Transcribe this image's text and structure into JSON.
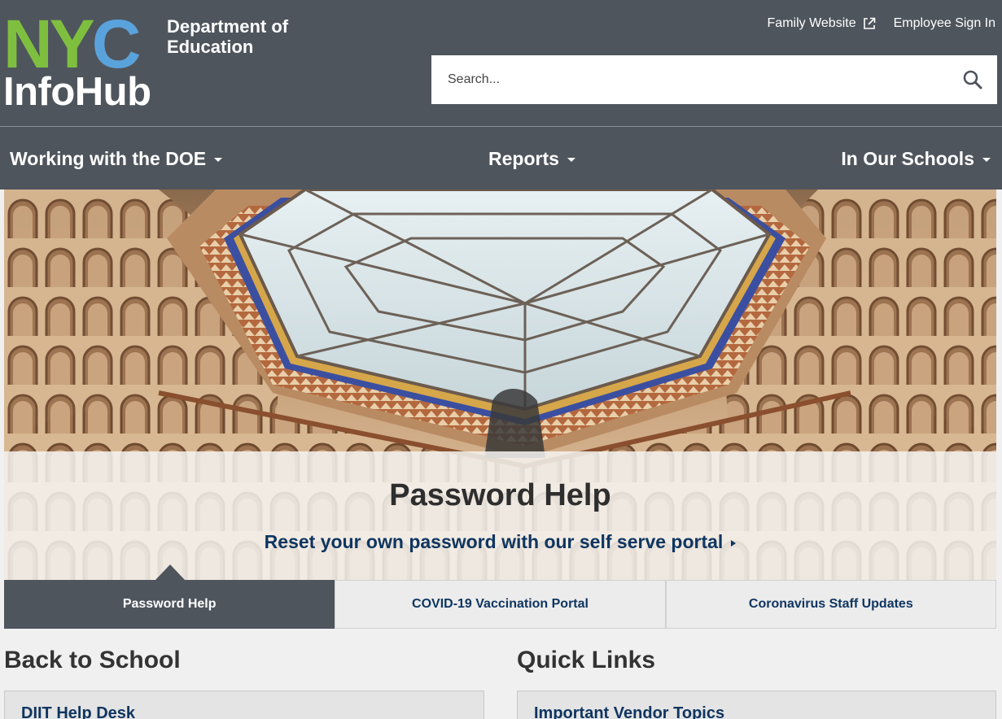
{
  "header": {
    "logo": {
      "nyc": "NYC",
      "department": "Department of",
      "education": "Education",
      "product": "InfoHub"
    },
    "top_links": [
      {
        "label": "Family Website",
        "icon": "external-link-icon"
      },
      {
        "label": "Employee Sign In"
      }
    ],
    "search": {
      "placeholder": "Search...",
      "icon": "search-icon"
    }
  },
  "nav": {
    "items": [
      {
        "label": "Working with the DOE",
        "icon": "caret-down-icon"
      },
      {
        "label": "Reports",
        "icon": "caret-down-icon"
      },
      {
        "label": "In Our Schools",
        "icon": "caret-down-icon"
      }
    ]
  },
  "hero": {
    "title": "Password Help",
    "link": "Reset your own password with our self serve portal"
  },
  "tabs": [
    {
      "label": "Password Help",
      "active": true
    },
    {
      "label": "COVID-19 Vaccination Portal",
      "active": false
    },
    {
      "label": "Coronavirus Staff Updates",
      "active": false
    }
  ],
  "sections": {
    "back_to_school": {
      "title": "Back to School",
      "first_item": "DIIT Help Desk"
    },
    "quick_links": {
      "title": "Quick Links",
      "first_item": "Important Vendor Topics"
    }
  },
  "colors": {
    "header_bg": "#4f555d",
    "nyc_n": "#7fbf3f",
    "nyc_y": "#7fbf3f",
    "nyc_c": "#5aa2dc",
    "link_navy": "#0f3560"
  }
}
